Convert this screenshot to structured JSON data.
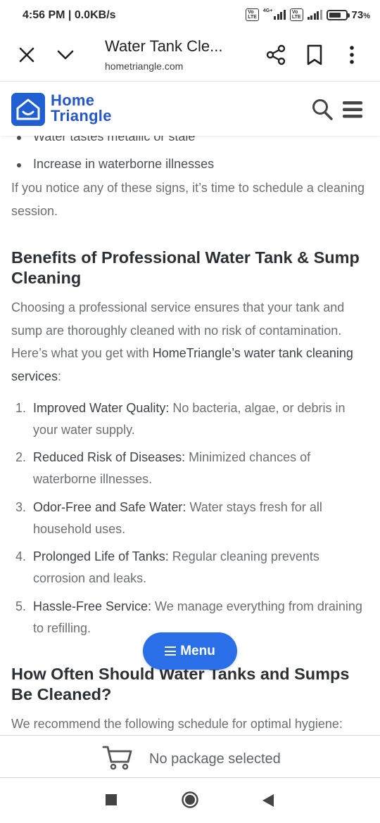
{
  "status_bar": {
    "time": "4:56 PM | 0.0KB/s",
    "network_type": "4G+",
    "volte_label": "Vo LTE",
    "battery_percent": "73",
    "battery_suffix": "%"
  },
  "browser": {
    "page_title": "Water Tank Cle...",
    "url": "hometriangle.com",
    "icons": [
      "close-icon",
      "chevron-down-icon",
      "share-icon",
      "bookmark-icon",
      "more-vert-icon"
    ]
  },
  "site_header": {
    "logo_line1": "Home",
    "logo_line2": "Triangle",
    "brand_color": "#1f5fd1",
    "icons": [
      "search-icon",
      "hamburger-menu-icon"
    ]
  },
  "content": {
    "cut_bullet": "Water tastes metallic or stale",
    "bullet": "Increase in waterborne illnesses",
    "intro_para": "If you notice any of these signs, it’s time to schedule a cleaning session.",
    "benefits_heading": "Benefits of Professional Water Tank & Sump Cleaning",
    "benefits_para_1": "Choosing a professional service ensures that your tank and sump are thoroughly cleaned with no risk of contamination. Here’s what you get with ",
    "benefits_para_brand": "HomeTriangle’s water tank cleaning services",
    "benefits_para_end": ":",
    "benefits": [
      {
        "num": "1.",
        "title": "Improved Water Quality:",
        "text": " No bacteria, algae, or debris in your water supply."
      },
      {
        "num": "2.",
        "title": "Reduced Risk of Diseases:",
        "text": " Minimized chances of waterborne illnesses."
      },
      {
        "num": "3.",
        "title": "Odor-Free and Safe Water:",
        "text": " Water stays fresh for all household uses."
      },
      {
        "num": "4.",
        "title": "Prolonged Life of Tanks:",
        "text": " Regular cleaning prevents corrosion and leaks."
      },
      {
        "num": "5.",
        "title": "Hassle-Free Service:",
        "text": " We manage everything from draining to refilling."
      }
    ],
    "frequency_heading": "How Often Should Water Tanks and Sumps Be Cleaned?",
    "frequency_para": "We recommend the following schedule for optimal hygiene:"
  },
  "floating_menu": {
    "label": "Menu",
    "color": "#2a6fe8"
  },
  "package_bar": {
    "text": "No package selected"
  }
}
